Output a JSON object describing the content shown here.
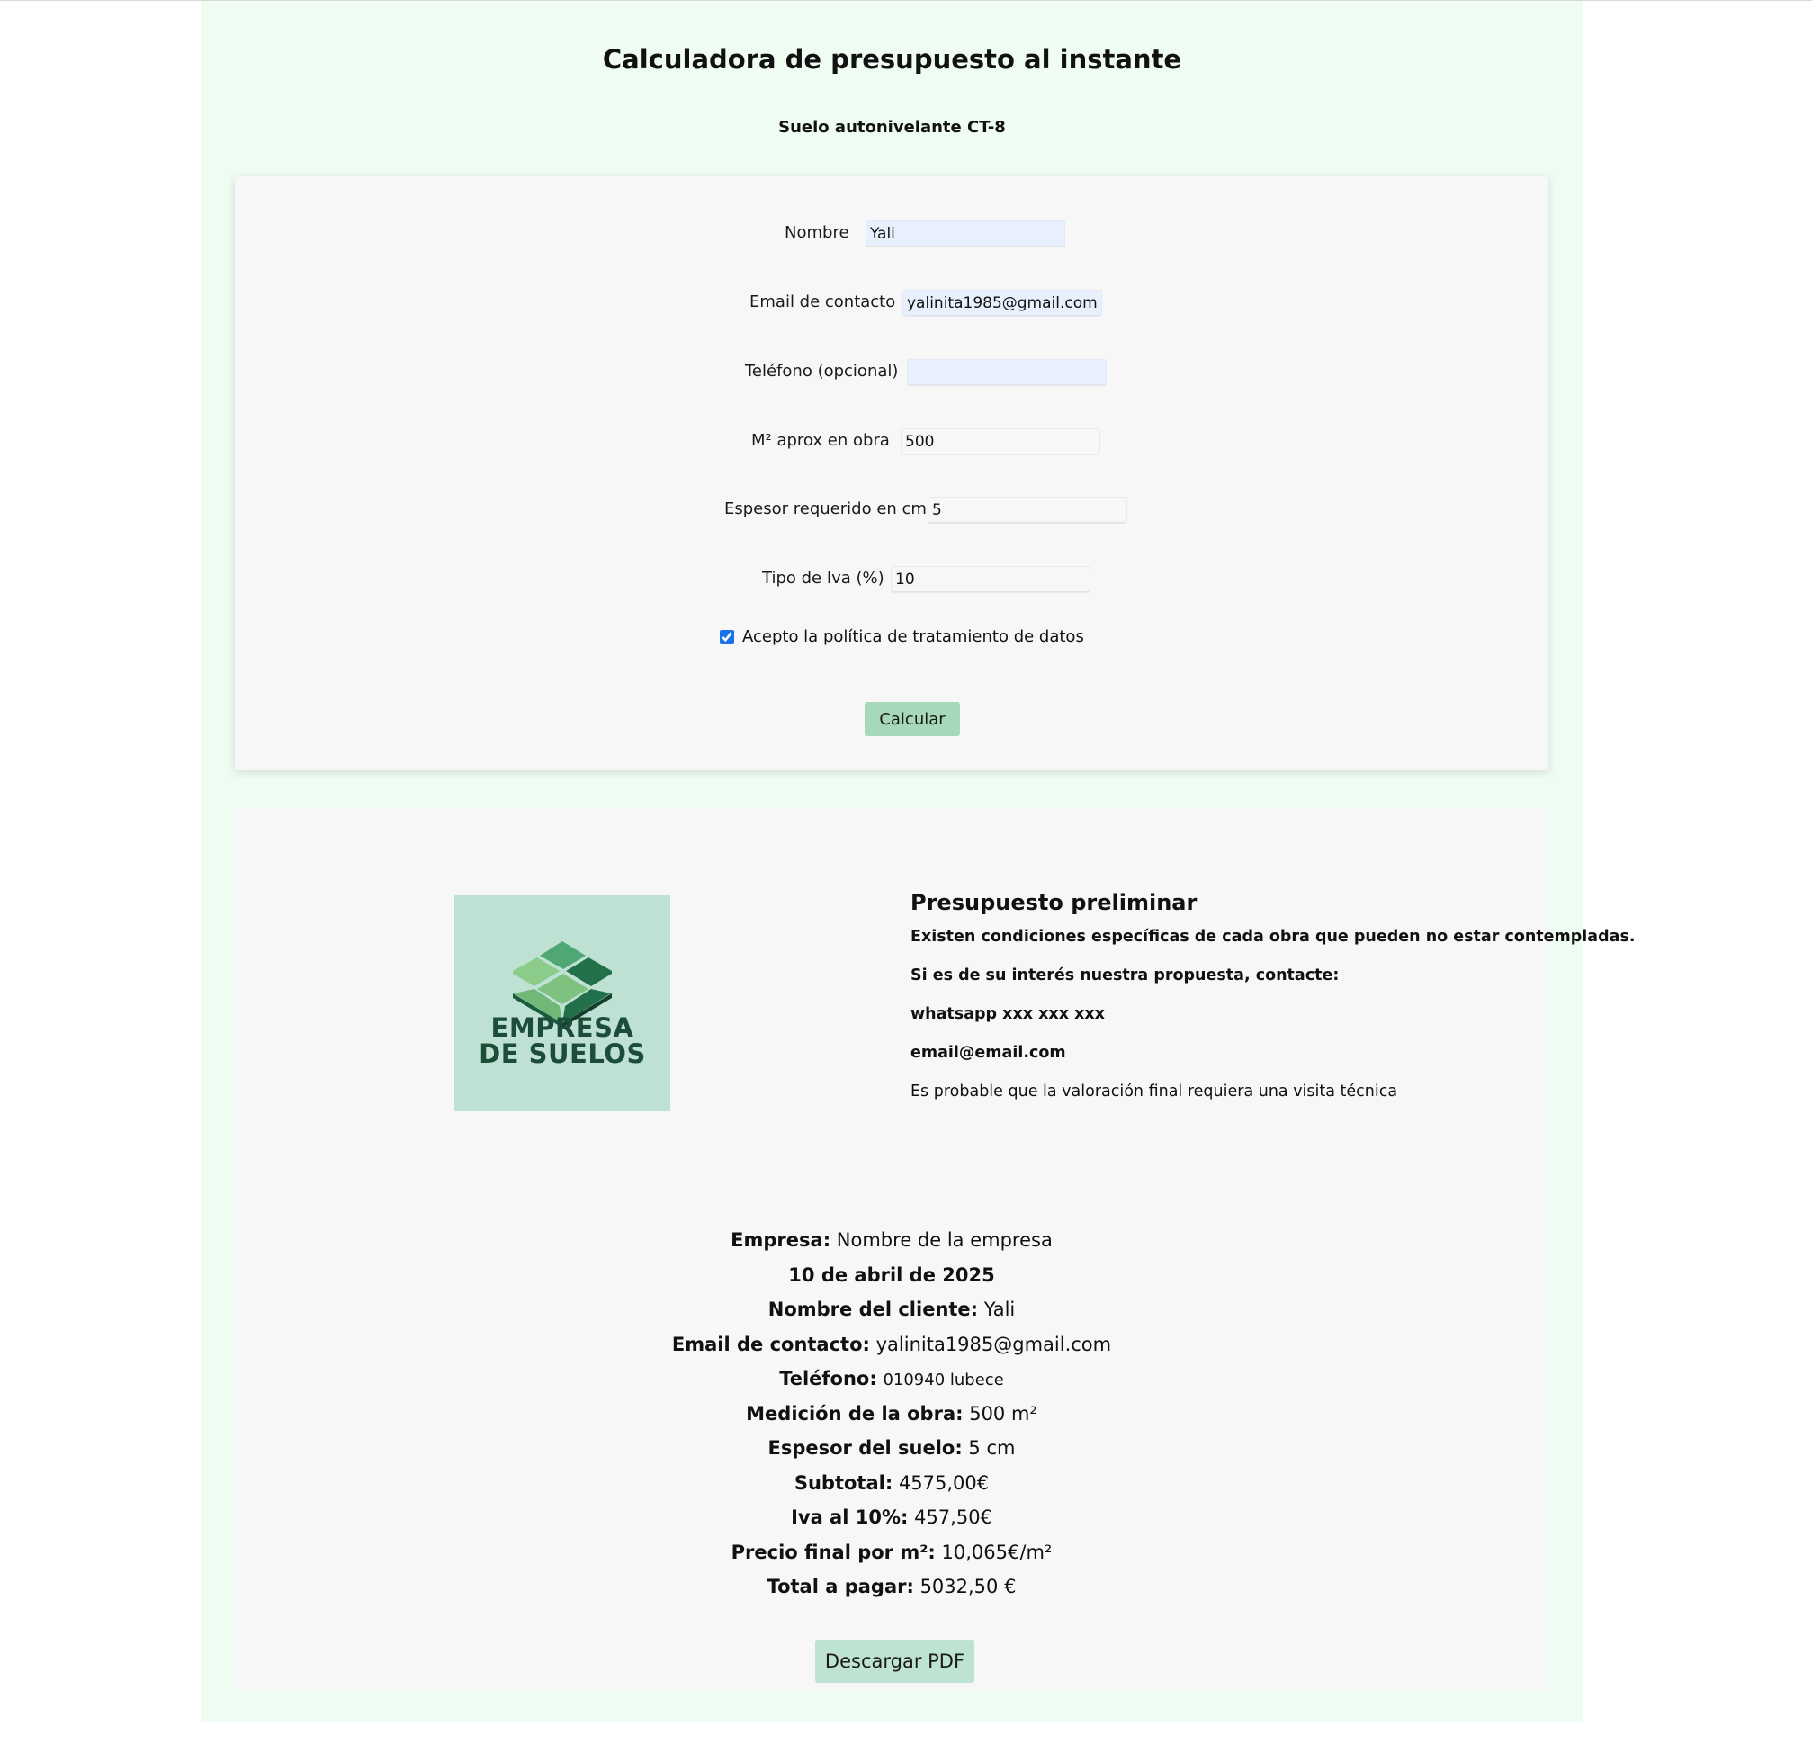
{
  "header": {
    "title": "Calculadora de presupuesto al instante",
    "subtitle": "Suelo autonivelante CT-8"
  },
  "form": {
    "name_label": "Nombre",
    "name_value": "Yali",
    "email_label": "Email de contacto",
    "email_value": "yalinita1985@gmail.com",
    "phone_label": "Teléfono (opcional)",
    "phone_value": "",
    "area_label": "M² aprox en obra",
    "area_value": "500",
    "thickness_label": "Espesor requerido en cm",
    "thickness_value": "5",
    "vat_label": "Tipo de Iva (%)",
    "vat_value": "10",
    "consent_label": "Acepto la política de tratamiento de datos",
    "consent_checked": true,
    "submit_label": "Calcular"
  },
  "result": {
    "logo_text": [
      "EMPRESA",
      "DE SUELOS"
    ],
    "logo_colors": {
      "background": "#bfe1d4",
      "tile_light": "#8ccc8a",
      "tile_mid": "#4fa874",
      "tile_dark": "#22704a",
      "text": "#1b4d3a"
    },
    "heading": "Presupuesto preliminar",
    "note": "Existen condiciones específicas de cada obra que pueden no estar contempladas.",
    "contact_intro": "Si es de su interés nuestra propuesta, contacte:",
    "whatsapp": "whatsapp xxx xxx xxx",
    "email": "email@email.com",
    "visit_note": "Es probable que la valoración final requiera una visita técnica",
    "summary": {
      "company_label": "Empresa:",
      "company_value": "Nombre de la empresa",
      "date": "10 de abril de 2025",
      "client_label": "Nombre del cliente:",
      "client_value": "Yali",
      "email_label": "Email de contacto:",
      "email_value": "yalinita1985@gmail.com",
      "phone_label": "Teléfono:",
      "phone_value": "010940 lubece",
      "measure_label": "Medición de la obra:",
      "measure_value": "500 m²",
      "thickness_label": "Espesor del suelo:",
      "thickness_value": "5 cm",
      "subtotal_label": "Subtotal:",
      "subtotal_value": "4575,00€",
      "vat_label": "Iva al 10%:",
      "vat_value": "457,50€",
      "unit_price_label": "Precio final por m²:",
      "unit_price_value": "10,065€/m²",
      "total_label": "Total a pagar:",
      "total_value": "5032,50 €"
    },
    "pdf_label": "Descargar PDF"
  }
}
